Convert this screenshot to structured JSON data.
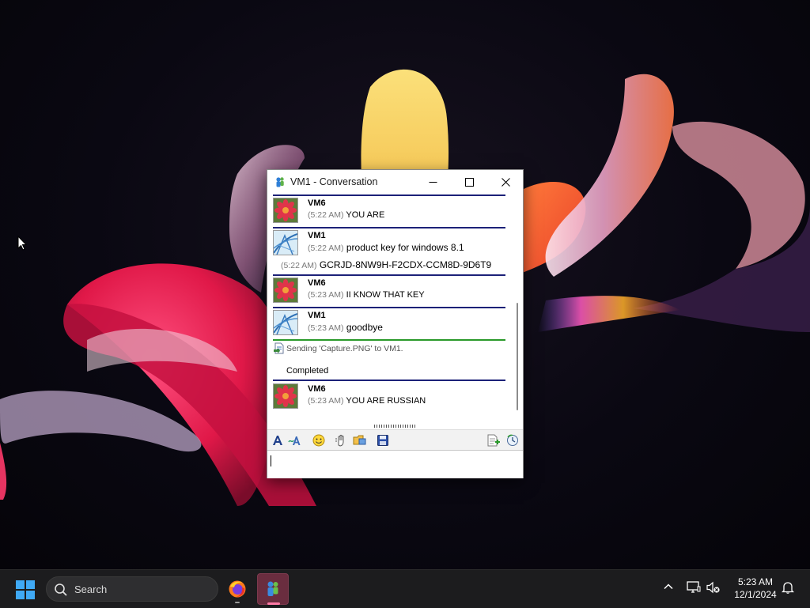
{
  "window": {
    "title": "VM1 - Conversation"
  },
  "messages": [
    {
      "sender": "VM6",
      "lines": [
        {
          "time": "(5:22 AM)",
          "text": "YOU ARE"
        }
      ]
    },
    {
      "sender": "VM1",
      "lines": [
        {
          "time": "(5:22 AM)",
          "text": "product key for windows 8.1"
        },
        {
          "time": "(5:22 AM)",
          "text": "GCRJD-8NW9H-F2CDX-CCM8D-9D6T9"
        }
      ]
    },
    {
      "sender": "VM6",
      "lines": [
        {
          "time": "(5:23 AM)",
          "text": "II KNOW THAT KEY"
        }
      ]
    },
    {
      "sender": "VM1",
      "lines": [
        {
          "time": "(5:23 AM)",
          "text": "goodbye"
        }
      ]
    },
    {
      "sender": "VM6",
      "lines": [
        {
          "time": "(5:23 AM)",
          "text": "YOU ARE RUSSIAN"
        }
      ]
    }
  ],
  "file_transfer": {
    "text": "Sending 'Capture.PNG' to VM1.",
    "status": "Completed"
  },
  "toolbar": {
    "tools": [
      "font-icon",
      "text-style-icon",
      "smiley-icon",
      "nudge-icon",
      "send-file-icon",
      "save-icon",
      "block-icon",
      "history-icon"
    ]
  },
  "input": {
    "value": ""
  },
  "taskbar": {
    "search_placeholder": "Search",
    "apps": [
      "Firefox",
      "Windows Messenger"
    ],
    "time": "5:23 AM",
    "date": "12/1/2024"
  },
  "colors": {
    "message_separator": "#1c2178",
    "transfer_separator": "#2a9a2a",
    "taskbar": "#1c1c1e"
  }
}
